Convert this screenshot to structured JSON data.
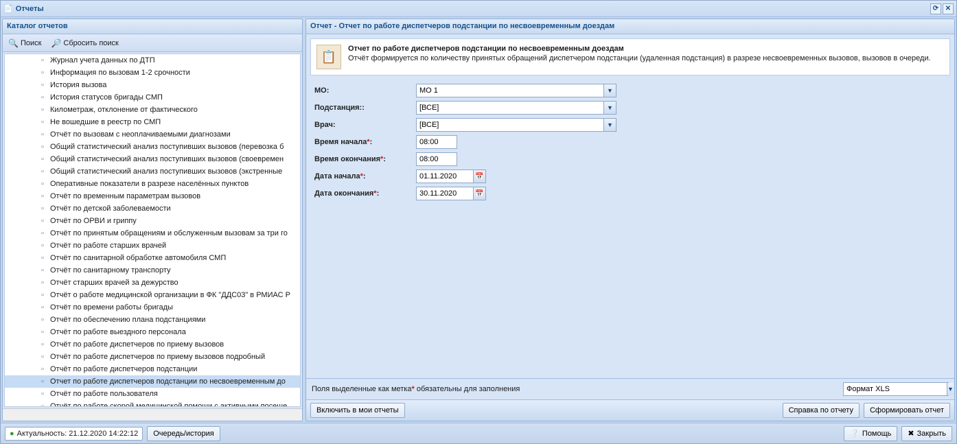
{
  "window": {
    "title": "Отчеты"
  },
  "left": {
    "header": "Каталог отчетов",
    "search_label": "Поиск",
    "reset_label": "Сбросить поиск",
    "items": [
      "Журнал учета данных по ДТП",
      "Информация по вызовам 1-2 срочности",
      "История вызова",
      "История статусов бригады СМП",
      "Километраж, отклонение от фактического",
      "Не вошедшие в реестр по СМП",
      "Отчёт по вызовам с неоплачиваемыми диагнозами",
      "Общий статистический анализ поступивших вызовов (перевозка б",
      "Общий статистический анализ поступивших вызовов (своевремен",
      "Общий статистический анализ поступивших вызовов (экстренные",
      "Оперативные показатели в разрезе населённых пунктов",
      "Отчёт по временным параметрам вызовов",
      "Отчёт по детской заболеваемости",
      "Отчёт по ОРВИ и гриппу",
      "Отчёт по принятым обращениям и обслуженным вызовам за три го",
      "Отчёт по работе старших врачей",
      "Отчёт по санитарной обработке автомобиля СМП",
      "Отчёт по санитарному транспорту",
      "Отчёт старших врачей за дежурство",
      "Отчёт о работе медицинской организации в ФК \"ДДС03\" в РМИАС Р",
      "Отчёт по времени работы бригады",
      "Отчёт по обеспечению плана подстанциями",
      "Отчёт по работе выездного персонала",
      "Отчёт по работе диспетчеров по приему вызовов",
      "Отчёт по работе диспетчеров по приему вызовов подробный",
      "Отчёт по работе диспетчеров подстанции",
      "Отчет по работе диспетчеров подстанции по несвоевременным до",
      "Отчёт по работе пользователя",
      "Отчёт по работе скорой медицинской помоши с активными посеше"
    ],
    "selected_index": 26
  },
  "right": {
    "header": "Отчет - Отчет по работе диспетчеров подстанции по несвоевременным доездам",
    "desc_title": "Отчет по работе диспетчеров подстанции по несвоевременным доездам",
    "desc_text": "Отчёт формируется по количеству принятых обращений диспетчером подстанции (удаленная подстанция) в разрезе несвоевременных вызовов, вызовов в очереди.",
    "form": {
      "mo_label": "МО:",
      "mo_value": "МО 1",
      "substation_label": "Подстанция::",
      "substation_value": "[ВСЕ]",
      "doctor_label": "Врач:",
      "doctor_value": "[ВСЕ]",
      "time_start_label": "Время начала",
      "time_start_value": "08:00",
      "time_end_label": "Время окончания",
      "time_end_value": "08:00",
      "date_start_label": "Дата начала",
      "date_start_value": "01.11.2020",
      "date_end_label": "Дата окончания",
      "date_end_value": "30.11.2020"
    },
    "hint_prefix": "Поля выделенные как ",
    "hint_mark": "метка",
    "hint_suffix": " обязательны для заполнения",
    "format_label": "Формат XLS",
    "btn_add_my": "Включить в мои отчеты",
    "btn_help_report": "Справка по отчету",
    "btn_generate": "Сформировать отчет"
  },
  "status": {
    "actual_label": "Актуальность: 21.12.2020 14:22:12",
    "queue_label": "Очередь/история",
    "help_label": "Помощь",
    "close_label": "Закрыть"
  }
}
